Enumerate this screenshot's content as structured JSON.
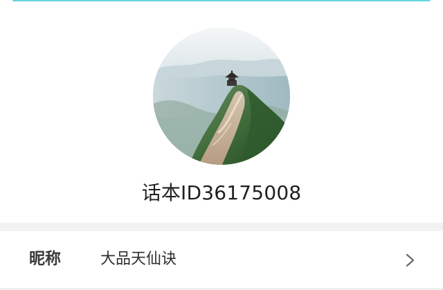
{
  "profile": {
    "username": "话本ID36175008",
    "avatar_icon": "avatar-mountain-pavilion-photo"
  },
  "settings_row": {
    "label": "昵称",
    "value": "大品天仙诀",
    "chevron_icon": "chevron-right-icon"
  },
  "colors": {
    "top_strip": "#67d5dd",
    "divider_band": "#f2f2f2",
    "label_text": "#3a3a3a",
    "value_text": "#2f2f2f",
    "chevron": "#6f6f6f"
  }
}
